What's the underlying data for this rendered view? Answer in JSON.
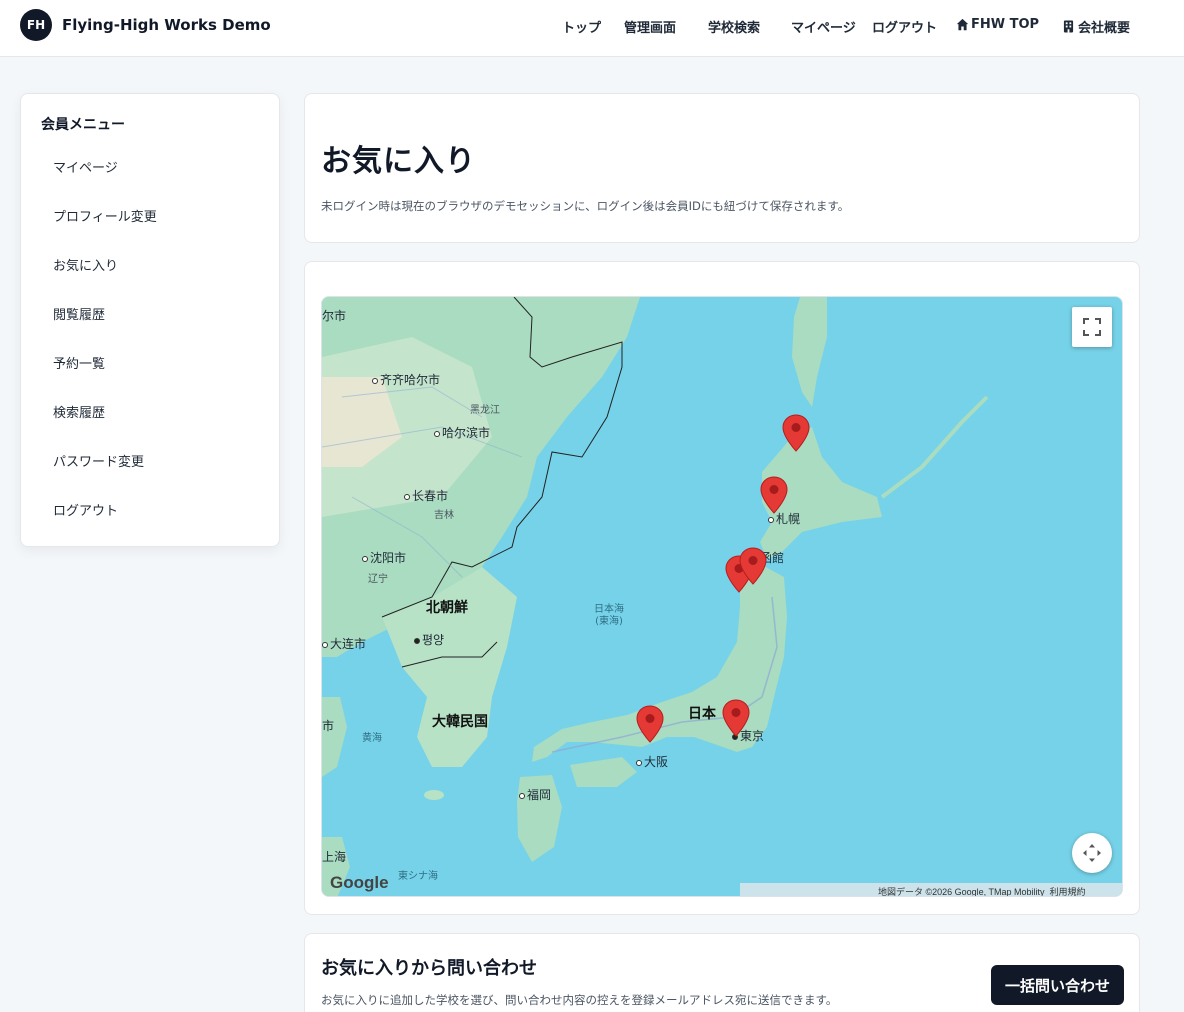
{
  "header": {
    "logo_text": "FH",
    "brand": "Flying-High Works Demo",
    "nav": [
      {
        "label": "トップ"
      },
      {
        "label": "管理画面"
      },
      {
        "label": "学校検索"
      },
      {
        "label": "マイページ"
      },
      {
        "label": "ログアウト"
      },
      {
        "label": "FHW TOP",
        "icon": "home-icon"
      },
      {
        "label": "会社概要",
        "icon": "building-icon"
      }
    ]
  },
  "sidebar": {
    "title": "会員メニュー",
    "items": [
      {
        "label": "マイページ"
      },
      {
        "label": "プロフィール変更"
      },
      {
        "label": "お気に入り"
      },
      {
        "label": "閲覧履歴"
      },
      {
        "label": "予約一覧"
      },
      {
        "label": "検索履歴"
      },
      {
        "label": "パスワード変更"
      },
      {
        "label": "ログアウト"
      }
    ]
  },
  "main": {
    "title": "お気に入り",
    "note": "未ログイン時は現在のブラウザのデモセッションに、ログイン後は会員IDにも紐づけて保存されます。"
  },
  "map": {
    "places": {
      "qiqihar": "齐齐哈尔市",
      "heilongjiang": "黑龙江",
      "harbin": "哈尔滨市",
      "changchun": "长春市",
      "jilin": "吉林",
      "shenyang": "沈阳市",
      "liaoning": "辽宁",
      "north_korea": "北朝鮮",
      "pyongyang": "평양",
      "dalian": "大连市",
      "south_korea": "大韓民国",
      "yellow_sea": "黄海",
      "sea_of_japan": "日本海",
      "east_sea": "(東海)",
      "japan": "日本",
      "tokyo": "東京",
      "osaka": "大阪",
      "fukuoka": "福岡",
      "sapporo": "札幌",
      "hakodate": "函館",
      "shanghai": "上海",
      "east_china_sea": "東シナ海",
      "edge_top": "尔市",
      "edge_left": "市"
    },
    "google": "Google",
    "attribution": "地図データ ©2026 Google, TMap Mobility",
    "terms": "利用規約",
    "controls": {
      "fullscreen": "fullscreen-icon",
      "camera": "camera-control-icon"
    },
    "marker_color": "#e53935",
    "marker_count": 6
  },
  "inquiry": {
    "title": "お気に入りから問い合わせ",
    "note": "お気に入りに追加した学校を選び、問い合わせ内容の控えを登録メールアドレス宛に送信できます。",
    "button": "一括問い合わせ"
  }
}
